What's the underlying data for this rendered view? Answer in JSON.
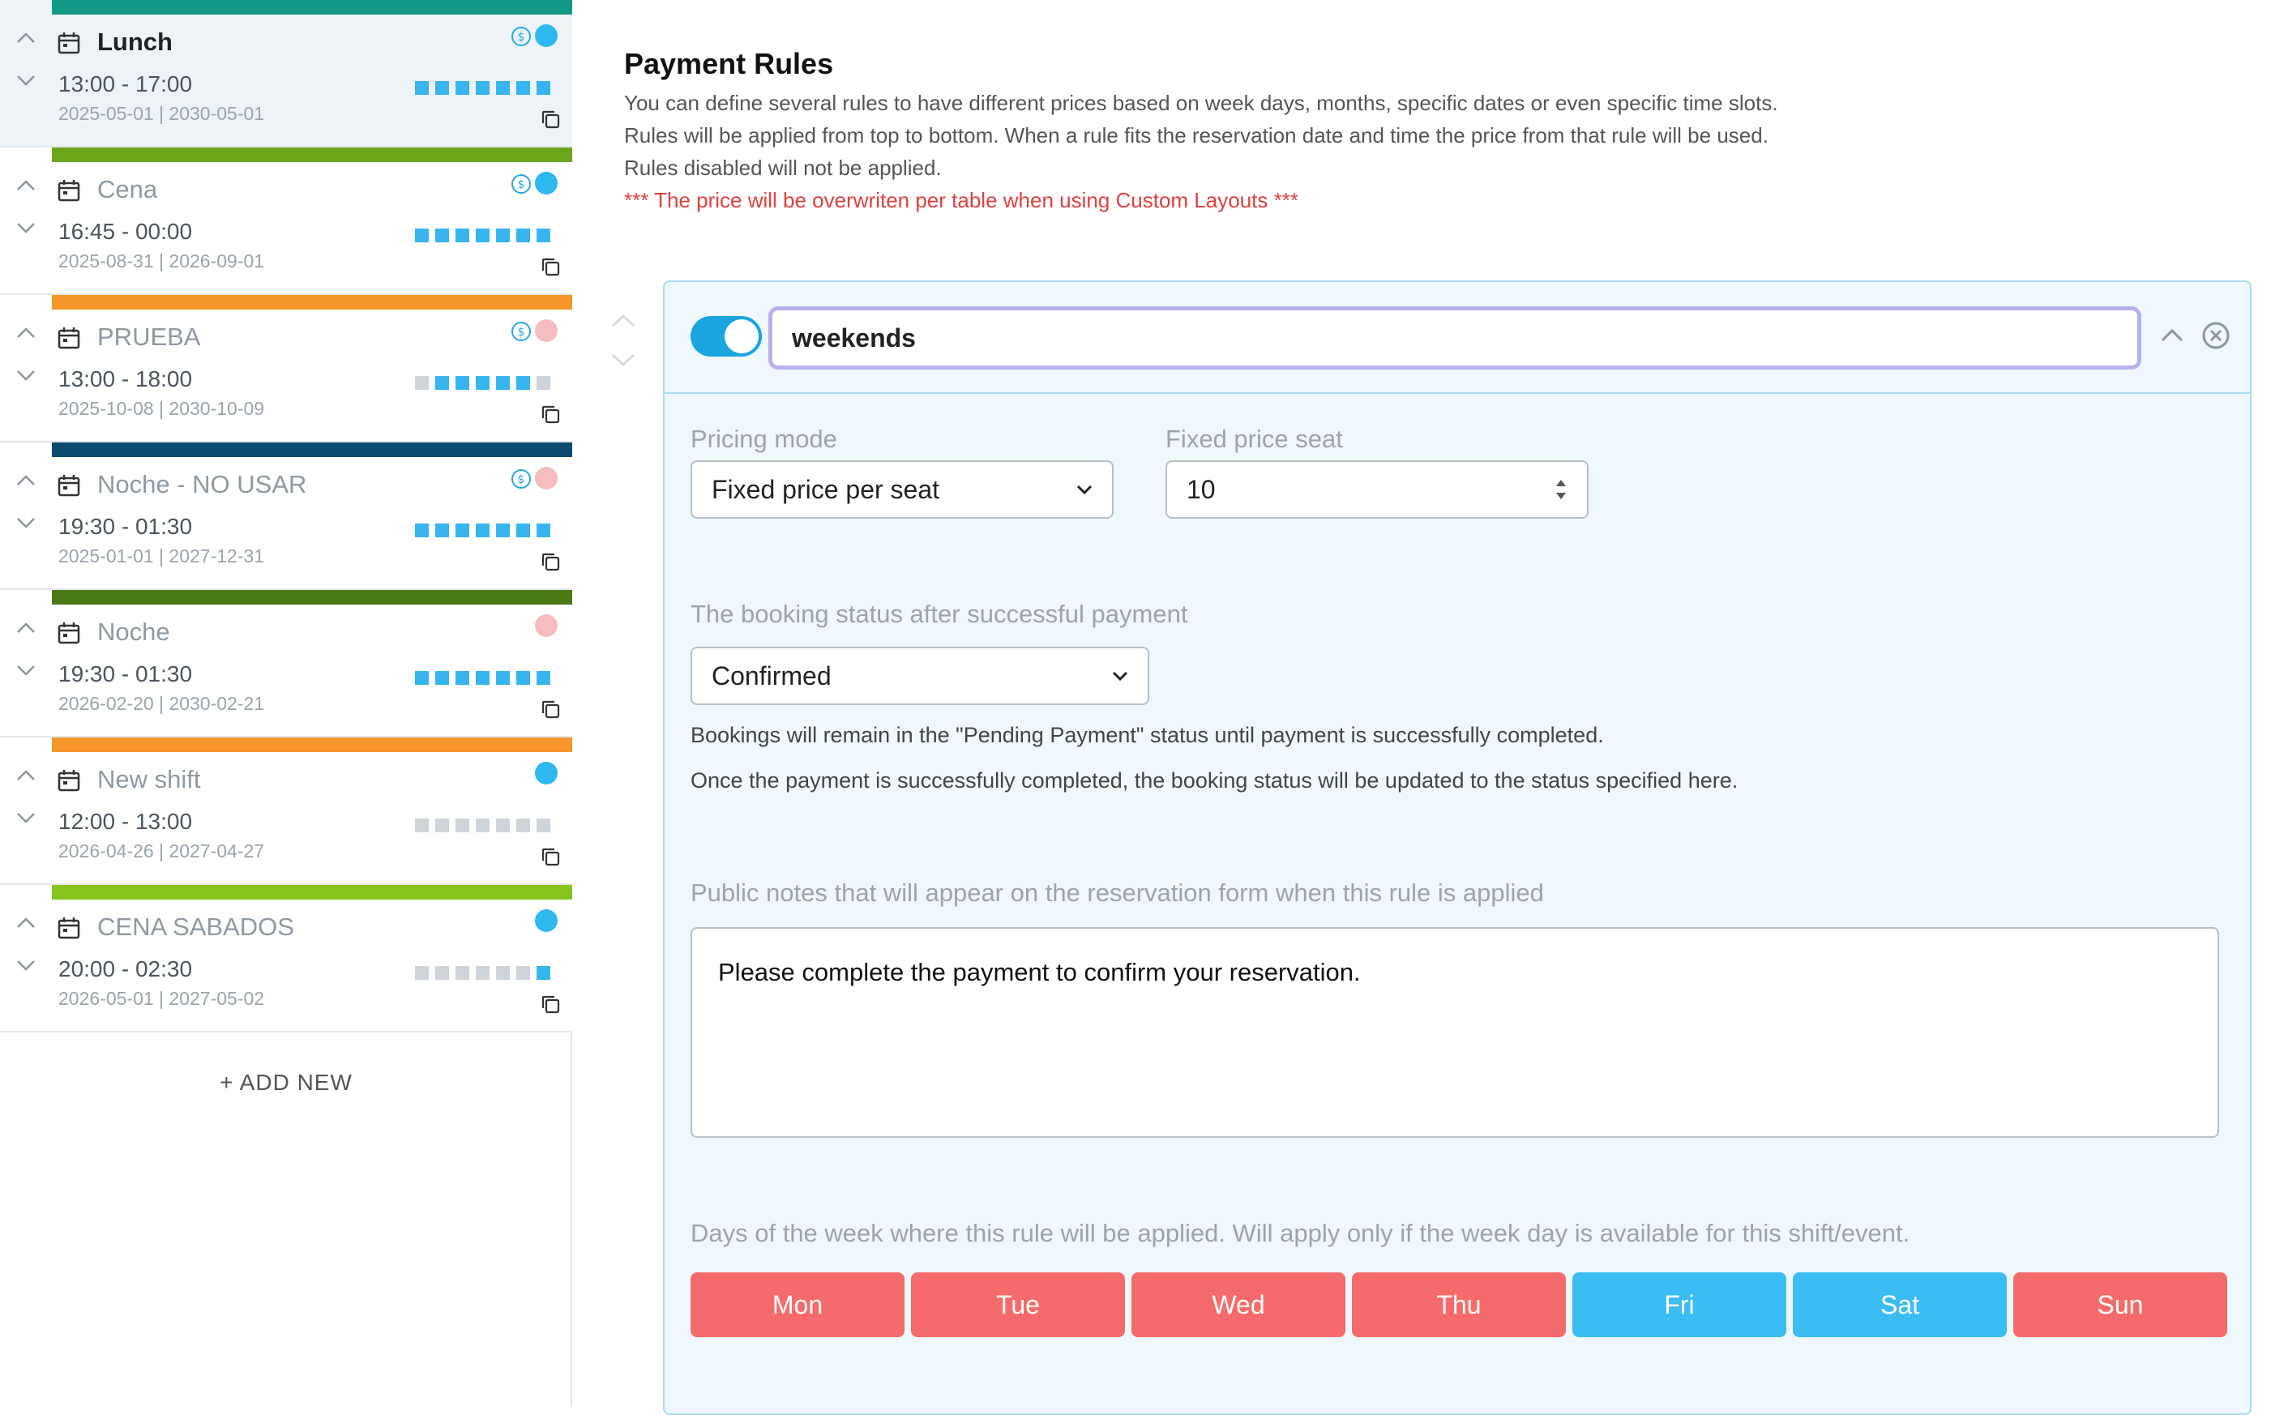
{
  "sidebar": {
    "shifts": [
      {
        "name": "Lunch",
        "time": "13:00 - 17:00",
        "dates": "2025-05-01 | 2030-05-01",
        "bar_color": "#129a86",
        "dot_color": "#2db8f0",
        "has_coin": true,
        "squares": "full"
      },
      {
        "name": "Cena",
        "time": "16:45 - 00:00",
        "dates": "2025-08-31 | 2026-09-01",
        "bar_color": "#6aa61a",
        "dot_color": "#2db8f0",
        "has_coin": true,
        "squares": "full"
      },
      {
        "name": "PRUEBA",
        "time": "13:00 - 18:00",
        "dates": "2025-10-08 | 2030-10-09",
        "bar_color": "#f7962a",
        "dot_color": "#f6bdc0",
        "has_coin": true,
        "squares": "partial"
      },
      {
        "name": "Noche - NO USAR",
        "time": "19:30 - 01:30",
        "dates": "2025-01-01 | 2027-12-31",
        "bar_color": "#0b4a6e",
        "dot_color": "#f6bdc0",
        "has_coin": true,
        "squares": "full"
      },
      {
        "name": "Noche",
        "time": "19:30 - 01:30",
        "dates": "2026-02-20 | 2030-02-21",
        "bar_color": "#4b7a14",
        "dot_color": "#f6bdc0",
        "has_coin": false,
        "squares": "full"
      },
      {
        "name": "New shift",
        "time": "12:00 - 13:00",
        "dates": "2026-04-26 | 2027-04-27",
        "bar_color": "#f7962a",
        "dot_color": "#2db8f0",
        "has_coin": false,
        "squares": "none"
      },
      {
        "name": "CENA SABADOS",
        "time": "20:00 - 02:30",
        "dates": "2026-05-01 | 2027-05-02",
        "bar_color": "#86c61c",
        "dot_color": "#2db8f0",
        "has_coin": false,
        "squares": "last"
      }
    ],
    "add_new_label": "+ ADD NEW"
  },
  "payment_rules": {
    "title": "Payment Rules",
    "description_lines": [
      "You can define several rules to have different prices based on week days, months, specific dates or even specific time slots.",
      "Rules will be applied from top to bottom. When a rule fits the reservation date and time the price from that rule will be used.",
      "Rules disabled will not be applied."
    ],
    "warning": "*** The price will be overwriten per table when using Custom Layouts ***"
  },
  "rule": {
    "enabled": true,
    "name": "weekends",
    "pricing_mode_label": "Pricing mode",
    "pricing_mode_value": "Fixed price per seat",
    "fixed_price_label": "Fixed price seat",
    "fixed_price_value": "10",
    "booking_status_label": "The booking status after successful payment",
    "booking_status_value": "Confirmed",
    "booking_note_1": "Bookings will remain in the \"Pending Payment\" status until payment is successfully completed.",
    "booking_note_2": "Once the payment is successfully completed, the booking status will be updated to the status specified here.",
    "public_notes_label": "Public notes that will appear on the reservation form when this rule is applied",
    "public_notes_value": "Please complete the payment to confirm your reservation.",
    "days_label": "Days of the week where this rule will be applied. Will apply only if the week day is available for this shift/event.",
    "days": [
      {
        "label": "Mon",
        "selected": false
      },
      {
        "label": "Tue",
        "selected": false
      },
      {
        "label": "Wed",
        "selected": false
      },
      {
        "label": "Thu",
        "selected": false
      },
      {
        "label": "Fri",
        "selected": true
      },
      {
        "label": "Sat",
        "selected": true
      },
      {
        "label": "Sun",
        "selected": false
      }
    ]
  },
  "colors": {
    "day_selected": "#3bbcf2",
    "day_unselected": "#f56b6b",
    "square_on": "#37b5ef",
    "square_off": "#cfd4da"
  }
}
